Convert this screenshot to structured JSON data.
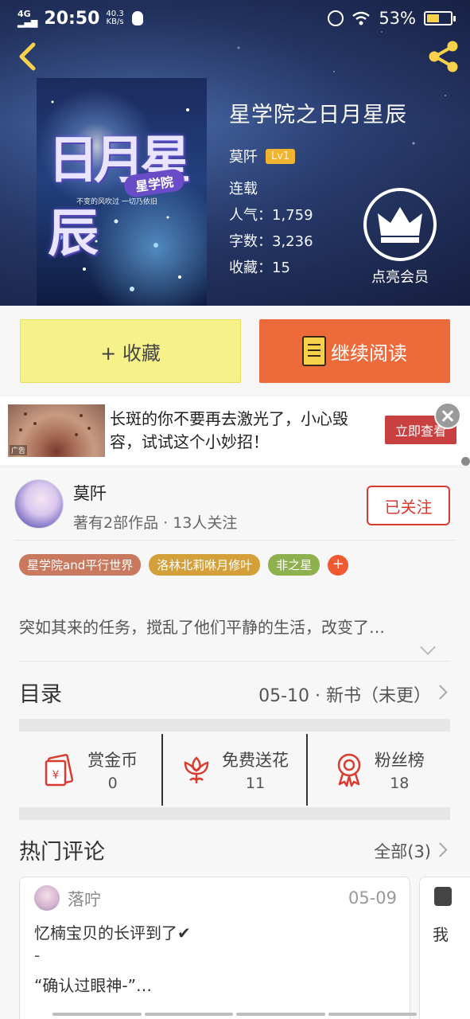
{
  "statusbar": {
    "network": "4G",
    "time": "20:50",
    "speed": "40.3",
    "speed_unit": "KB/s",
    "battery": "53%",
    "battery_level": 0.53
  },
  "book": {
    "title": "星学院之日月星辰",
    "author": "莫阡",
    "level": "Lv1",
    "status": "连载",
    "popularity_label": "人气：",
    "popularity": "1,759",
    "words_label": "字数：",
    "words": "3,236",
    "collect_label": "收藏：",
    "collect": "15",
    "cover": {
      "big_title": "日月星辰",
      "sub_title": "星学院",
      "tagline": "不变的风吹过 一切乃依旧"
    }
  },
  "vip": {
    "label": "点亮会员"
  },
  "actions": {
    "collect": "+ 收藏",
    "read": "继续阅读"
  },
  "ad": {
    "text": "长斑的你不要再去激光了，小心毁容，试试这个小妙招！",
    "button": "立即查看",
    "mark": "广告"
  },
  "author_card": {
    "name": "莫阡",
    "stats": "著有2部作品 · 13人关注",
    "follow": "已关注"
  },
  "tags": [
    {
      "label": "星学院and平行世界",
      "color": "#c97a5e"
    },
    {
      "label": "洛林北莉咻月修叶",
      "color": "#d4a03a"
    },
    {
      "label": "非之星",
      "color": "#8fb04e"
    }
  ],
  "tag_more": "+",
  "synopsis": "突如其来的任务，搅乱了他们平静的生活，改变了…",
  "toc": {
    "label": "目录",
    "info": "05-10 · 新书（未更）"
  },
  "rewards": [
    {
      "label": "赏金币",
      "value": "0",
      "icon": "red-envelope-icon"
    },
    {
      "label": "免费送花",
      "value": "11",
      "icon": "flower-icon"
    },
    {
      "label": "粉丝榜",
      "value": "18",
      "icon": "medal-icon"
    }
  ],
  "comments": {
    "title": "热门评论",
    "all": "全部(3)",
    "items": [
      {
        "user": "落咛",
        "date": "05-09",
        "line1": "忆楠宝贝的长评到了✔",
        "line2": "-",
        "line3": "“确认过眼神-”…"
      }
    ],
    "peek": "我"
  },
  "colors": {
    "accent": "#ed6a3a",
    "collect_bg": "#f7f18a",
    "follow": "#d93b30"
  }
}
